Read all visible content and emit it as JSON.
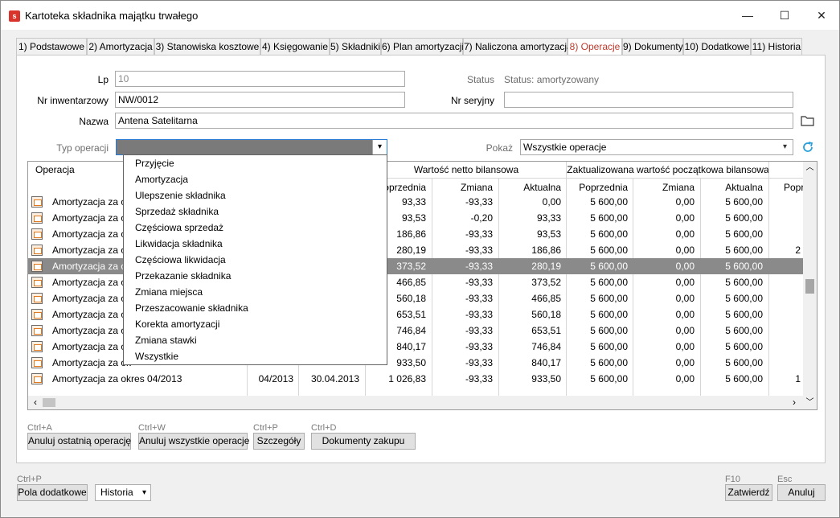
{
  "window": {
    "title": "Kartoteka składnika majątku trwałego",
    "icon_letter": "s",
    "minimize": "—",
    "maximize": "☐",
    "close": "✕"
  },
  "tabs": [
    "1) Podstawowe",
    "2) Amortyzacja",
    "3) Stanowiska kosztowe",
    "4) Księgowanie",
    "5) Składniki",
    "6) Plan amortyzacji",
    "7) Naliczona amortyzacja",
    "8) Operacje",
    "9) Dokumenty",
    "10) Dodatkowe",
    "11) Historia"
  ],
  "active_tab": "8) Operacje",
  "form": {
    "lp_label": "Lp",
    "lp_value": "10",
    "status_label": "Status",
    "status_value": "Status: amortyzowany",
    "nr_inw_label": "Nr inwentarzowy",
    "nr_inw_value": "NW/0012",
    "nr_ser_label": "Nr seryjny",
    "nr_ser_value": "",
    "nazwa_label": "Nazwa",
    "nazwa_value": "Antena Satelitarna",
    "typ_label": "Typ operacji",
    "typ_value": "",
    "pokaz_label": "Pokaż",
    "pokaz_value": "Wszystkie operacje"
  },
  "grid": {
    "col_operacja": "Operacja",
    "group_netto": "Wartość netto bilansowa",
    "group_zakt": "Zaktualizowana wartość początkowa bilansowa",
    "sub_poprzednia": "Poprzednia",
    "sub_zmiana": "Zmiana",
    "sub_aktualna": "Aktualna",
    "sub_extra": "Popr",
    "rows": [
      {
        "op": "Amortyzacja za ok",
        "period": "",
        "date": "",
        "np": "93,33",
        "nz": "-93,33",
        "na": "0,00",
        "zp": "5 600,00",
        "zz": "0,00",
        "za": "5 600,00",
        "ex": ""
      },
      {
        "op": "Amortyzacja za ok",
        "period": "",
        "date": "",
        "np": "93,53",
        "nz": "-0,20",
        "na": "93,33",
        "zp": "5 600,00",
        "zz": "0,00",
        "za": "5 600,00",
        "ex": ""
      },
      {
        "op": "Amortyzacja za ok",
        "period": "",
        "date": "",
        "np": "186,86",
        "nz": "-93,33",
        "na": "93,53",
        "zp": "5 600,00",
        "zz": "0,00",
        "za": "5 600,00",
        "ex": ""
      },
      {
        "op": "Amortyzacja za ok",
        "period": "",
        "date": "",
        "np": "280,19",
        "nz": "-93,33",
        "na": "186,86",
        "zp": "5 600,00",
        "zz": "0,00",
        "za": "5 600,00",
        "ex": "2"
      },
      {
        "op": "Amortyzacja za ok",
        "period": "",
        "date": "",
        "np": "373,52",
        "nz": "-93,33",
        "na": "280,19",
        "zp": "5 600,00",
        "zz": "0,00",
        "za": "5 600,00",
        "ex": "",
        "selected": true
      },
      {
        "op": "Amortyzacja za ok",
        "period": "",
        "date": "",
        "np": "466,85",
        "nz": "-93,33",
        "na": "373,52",
        "zp": "5 600,00",
        "zz": "0,00",
        "za": "5 600,00",
        "ex": ""
      },
      {
        "op": "Amortyzacja za ok",
        "period": "",
        "date": "",
        "np": "560,18",
        "nz": "-93,33",
        "na": "466,85",
        "zp": "5 600,00",
        "zz": "0,00",
        "za": "5 600,00",
        "ex": ""
      },
      {
        "op": "Amortyzacja za ok",
        "period": "",
        "date": "",
        "np": "653,51",
        "nz": "-93,33",
        "na": "560,18",
        "zp": "5 600,00",
        "zz": "0,00",
        "za": "5 600,00",
        "ex": ""
      },
      {
        "op": "Amortyzacja za ok",
        "period": "",
        "date": "",
        "np": "746,84",
        "nz": "-93,33",
        "na": "653,51",
        "zp": "5 600,00",
        "zz": "0,00",
        "za": "5 600,00",
        "ex": ""
      },
      {
        "op": "Amortyzacja za ok",
        "period": "",
        "date": "",
        "np": "840,17",
        "nz": "-93,33",
        "na": "746,84",
        "zp": "5 600,00",
        "zz": "0,00",
        "za": "5 600,00",
        "ex": ""
      },
      {
        "op": "Amortyzacja za ok",
        "period": "",
        "date": "",
        "np": "933,50",
        "nz": "-93,33",
        "na": "840,17",
        "zp": "5 600,00",
        "zz": "0,00",
        "za": "5 600,00",
        "ex": ""
      },
      {
        "op": "Amortyzacja za okres 04/2013",
        "period": "04/2013",
        "date": "30.04.2013",
        "np": "1 026,83",
        "nz": "-93,33",
        "na": "933,50",
        "zp": "5 600,00",
        "zz": "0,00",
        "za": "5 600,00",
        "ex": "1"
      }
    ]
  },
  "dropdown": {
    "items": [
      "Przyjęcie",
      "Amortyzacja",
      "Ulepszenie składnika",
      "Sprzedaż składnika",
      "Częściowa sprzedaż",
      "Likwidacja składnika",
      "Częściowa likwidacja",
      "Przekazanie składnika",
      "Zmiana miejsca",
      "Przeszacowanie składnika",
      "Korekta amortyzacji",
      "Zmiana stawki",
      "Wszystkie"
    ]
  },
  "actions": {
    "hint_anuluj_ost": "Ctrl+A",
    "anuluj_ost": "Anuluj ostatnią operację",
    "hint_anuluj_wsz": "Ctrl+W",
    "anuluj_wsz": "Anuluj wszystkie operacje",
    "hint_szczegoly": "Ctrl+P",
    "szczegoly": "Szczegóły",
    "hint_dok": "Ctrl+D",
    "dokumenty": "Dokumenty zakupu"
  },
  "footer": {
    "hint_pola": "Ctrl+P",
    "pola": "Pola dodatkowe",
    "historia": "Historia",
    "hint_zatw": "F10",
    "zatwierdz": "Zatwierdź",
    "hint_anuluj": "Esc",
    "anuluj": "Anuluj"
  }
}
